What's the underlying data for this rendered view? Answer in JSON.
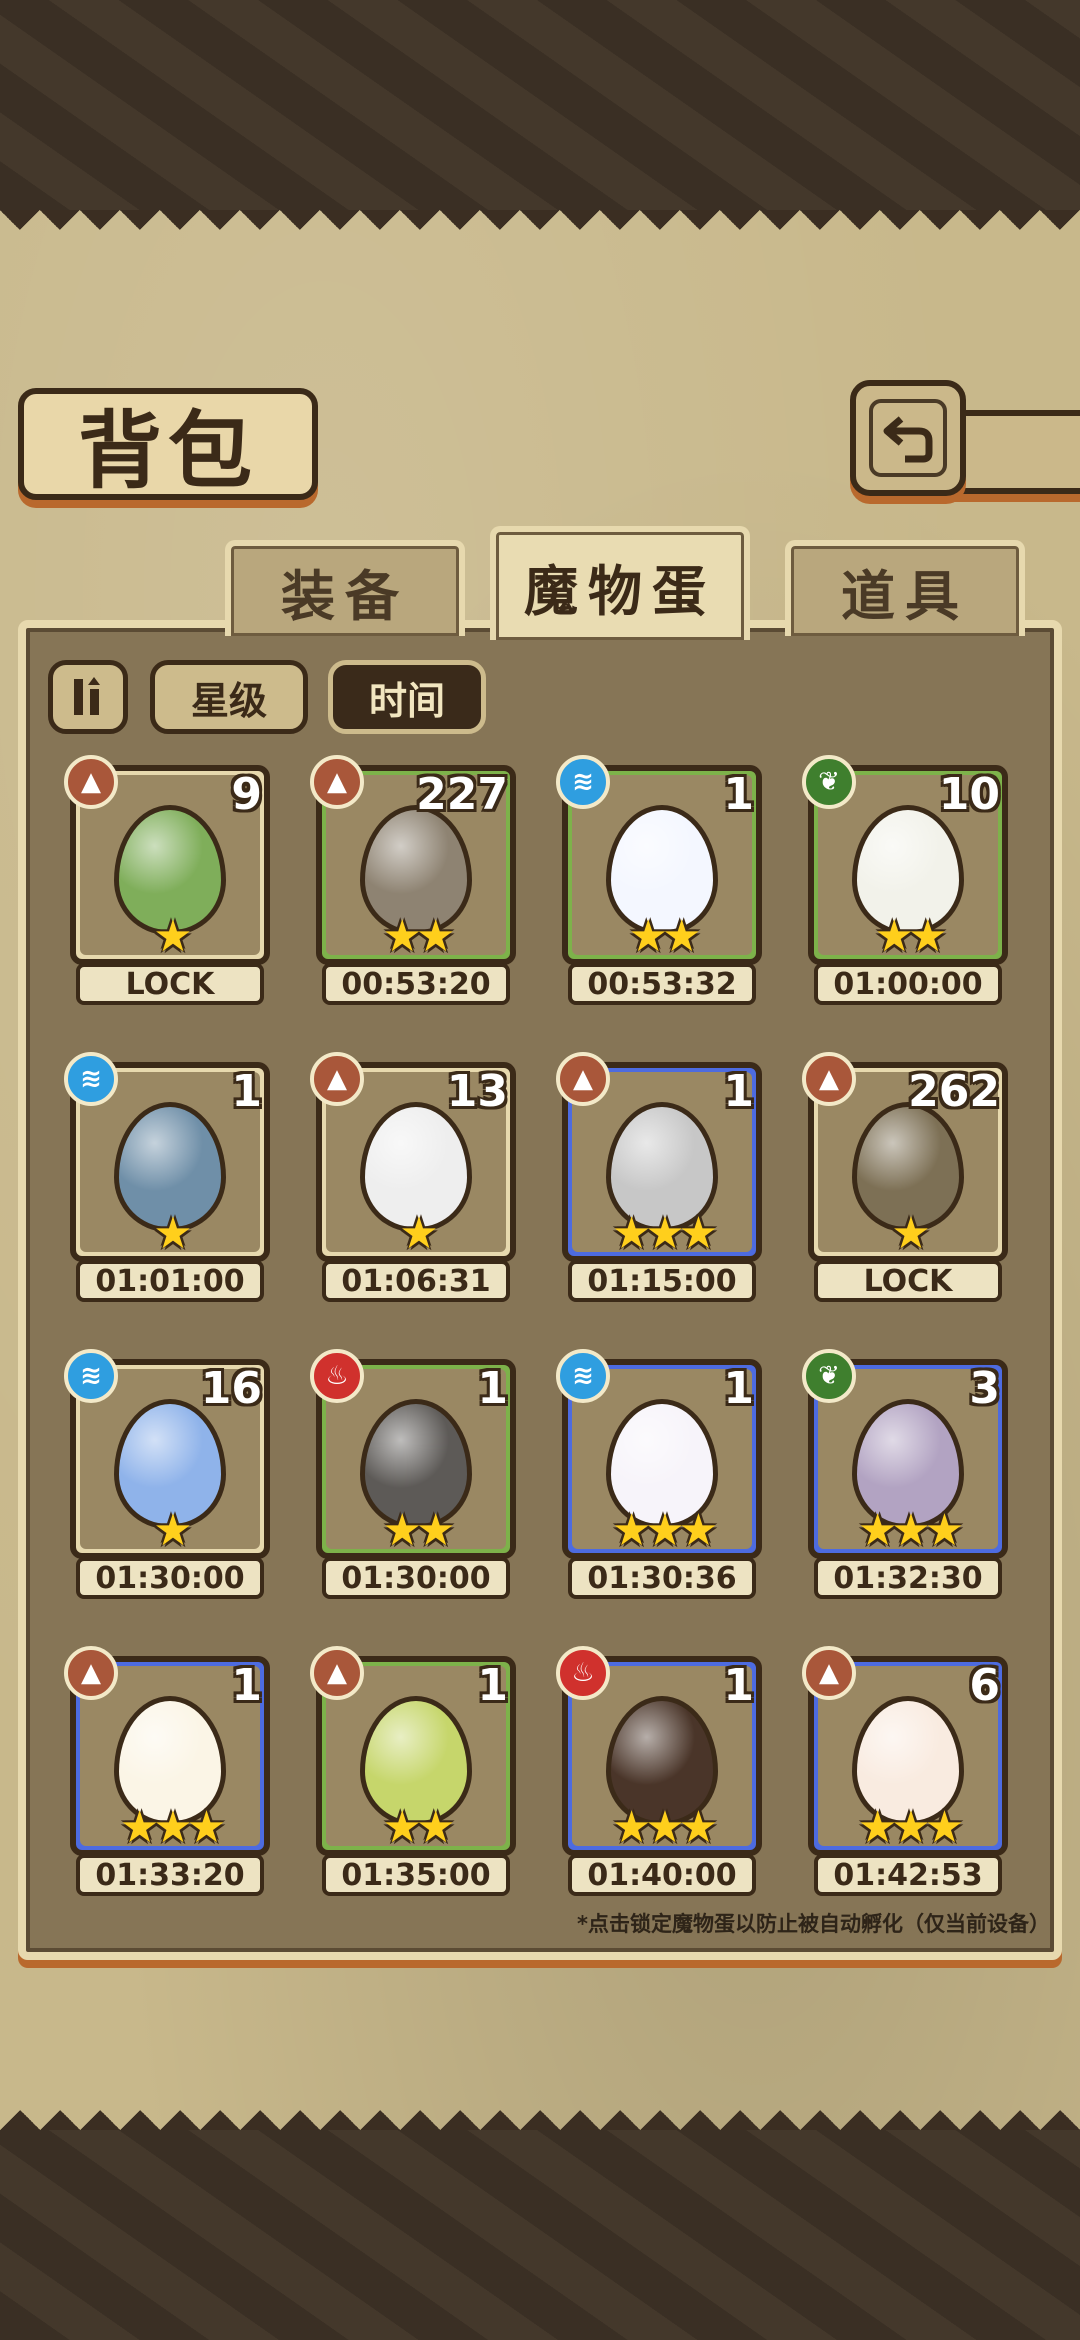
{
  "header": {
    "title": "背包"
  },
  "tabs": [
    {
      "label": "装备",
      "active": false
    },
    {
      "label": "魔物蛋",
      "active": true
    },
    {
      "label": "道具",
      "active": false
    }
  ],
  "sort": {
    "star_label": "星级",
    "time_label": "时间",
    "selected": "时间"
  },
  "eggs": [
    {
      "count": "9",
      "label": "LOCK",
      "stars": "★",
      "element": "earth",
      "egg_color": "#7fae5a"
    },
    {
      "count": "227",
      "label": "00:53:20",
      "stars": "★★",
      "element": "earth",
      "egg_color": "#8e8372"
    },
    {
      "count": "1",
      "label": "00:53:32",
      "stars": "★★",
      "element": "water",
      "egg_color": "#f4f7ff"
    },
    {
      "count": "10",
      "label": "01:00:00",
      "stars": "★★",
      "element": "wood",
      "egg_color": "#f2f2ea"
    },
    {
      "count": "1",
      "label": "01:01:00",
      "stars": "★",
      "element": "water",
      "egg_color": "#6f8fa8"
    },
    {
      "count": "13",
      "label": "01:06:31",
      "stars": "★",
      "element": "earth",
      "egg_color": "#eeeeee"
    },
    {
      "count": "1",
      "label": "01:15:00",
      "stars": "★★★",
      "element": "earth",
      "egg_color": "#c7c7c7"
    },
    {
      "count": "262",
      "label": "LOCK",
      "stars": "★",
      "element": "earth",
      "egg_color": "#7d7055"
    },
    {
      "count": "16",
      "label": "01:30:00",
      "stars": "★",
      "element": "water",
      "egg_color": "#8fb3ea"
    },
    {
      "count": "1",
      "label": "01:30:00",
      "stars": "★★",
      "element": "fire",
      "egg_color": "#5d5a57"
    },
    {
      "count": "1",
      "label": "01:30:36",
      "stars": "★★★",
      "element": "water",
      "egg_color": "#f7f4fa"
    },
    {
      "count": "3",
      "label": "01:32:30",
      "stars": "★★★",
      "element": "wood",
      "egg_color": "#b2a3c2"
    },
    {
      "count": "1",
      "label": "01:33:20",
      "stars": "★★★",
      "element": "earth",
      "egg_color": "#fbf5e6"
    },
    {
      "count": "1",
      "label": "01:35:00",
      "stars": "★★",
      "element": "earth",
      "egg_color": "#c6d66b"
    },
    {
      "count": "1",
      "label": "01:40:00",
      "stars": "★★★",
      "element": "fire",
      "egg_color": "#4a3529"
    },
    {
      "count": "6",
      "label": "01:42:53",
      "stars": "★★★",
      "element": "earth",
      "egg_color": "#f9ebe0"
    }
  ],
  "footer_hint": "*点击锁定魔物蛋以防止被自动孵化（仅当前设备）",
  "element_colors": {
    "earth": "#a9573a",
    "water": "#2f9ee0",
    "wood": "#3f7f2e",
    "fire": "#d0312d"
  }
}
